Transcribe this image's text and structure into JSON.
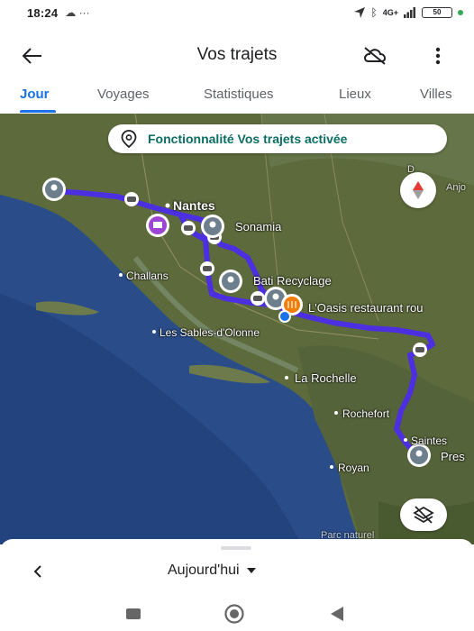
{
  "status_bar": {
    "time": "18:24",
    "extra": "☁ ···",
    "network": "4G+",
    "battery": "50"
  },
  "app_bar": {
    "title": "Vos trajets"
  },
  "tabs": [
    {
      "label": "Jour",
      "active": true
    },
    {
      "label": "Voyages",
      "active": false
    },
    {
      "label": "Statistiques",
      "active": false
    },
    {
      "label": "Lieux",
      "active": false
    },
    {
      "label": "Villes",
      "active": false
    }
  ],
  "map": {
    "banner": "Fonctionnalité Vos trajets activée",
    "places": {
      "nantes": "Nantes",
      "sonamia": "Sonamia",
      "challans": "Challans",
      "bati": "Bati Recyclage",
      "oasis": "L'Oasis restaurant rou",
      "sables": "Les Sables-d'Olonne",
      "rochelle": "La Rochelle",
      "rochefort": "Rochefort",
      "saintes": "Saintes",
      "royan": "Royan",
      "pres": "Pres",
      "parc": "Parc naturel",
      "anjou_a": "D",
      "anjou_b": "Anjo"
    },
    "route_color": "#4b2fe0",
    "pin_color": "#6d7f8c",
    "accent_orange": "#f57c00",
    "accent_purple": "#9c44d4"
  },
  "sheet": {
    "date_label": "Aujourd'hui"
  },
  "icons": {
    "back": "arrow-left-icon",
    "cloud": "cloud-off-icon",
    "more": "more-vert-icon",
    "compass": "compass-icon",
    "layers": "layers-off-icon",
    "prev": "chevron-left-icon",
    "dropdown": "caret-down-icon"
  }
}
